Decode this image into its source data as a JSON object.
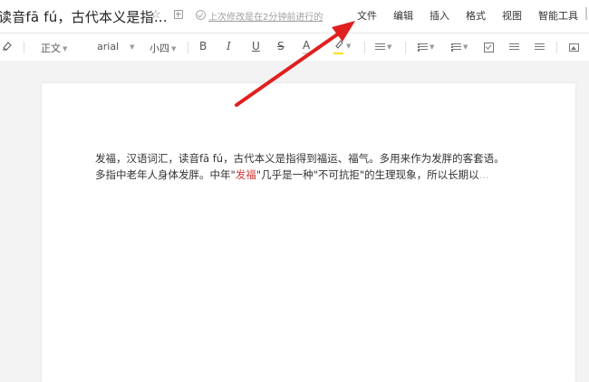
{
  "header": {
    "doc_title": "读音fā fú，古代本义是指...",
    "save_status": "上次修改是在2分钟前进行的",
    "menus": [
      "文件",
      "编辑",
      "插入",
      "格式",
      "视图",
      "智能工具"
    ]
  },
  "toolbar": {
    "paragraph_style": "正文",
    "font_family": "arial",
    "font_size": "小四",
    "bold": "B",
    "italic": "I",
    "underline": "U",
    "strikethrough": "S",
    "font_color": "A"
  },
  "document": {
    "line1": "发福，汉语词汇，读音fā fú，古代本义是指得到福运、福气。多用来作为发胖的客套语。",
    "line2_a": "多指中老年人身体发胖。中年",
    "line2_quote_open": "\"",
    "line2_red": "发福",
    "line2_b": "\"几乎是一种\"不可抗拒\"的生理现象，所以长期以",
    "line2_fade": "..."
  },
  "colors": {
    "arrow": "#e02020",
    "highlight_accent": "#f5e000",
    "red_text": "#d23a3a"
  }
}
